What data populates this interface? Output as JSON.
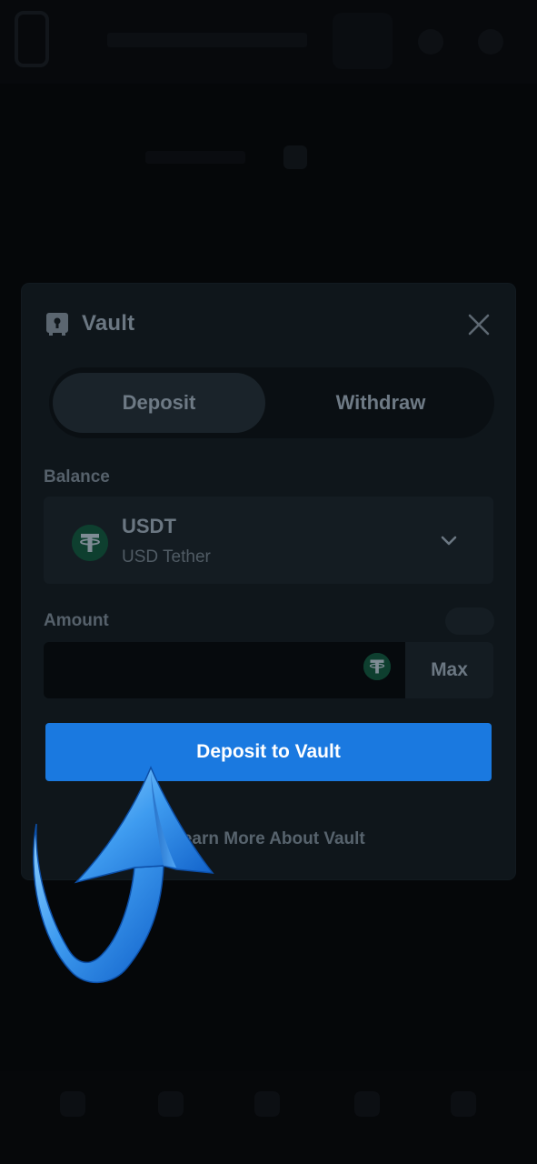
{
  "modal": {
    "title": "Vault",
    "title_icon": "vault-icon",
    "close_icon": "close-icon",
    "tabs": [
      {
        "label": "Deposit",
        "active": true
      },
      {
        "label": "Withdraw",
        "active": false
      }
    ],
    "balance_label": "Balance",
    "currency": {
      "code": "USDT",
      "name": "USD Tether",
      "icon": "tether-icon",
      "dropdown_icon": "chevron-down-icon"
    },
    "amount_label": "Amount",
    "amount": {
      "value": "",
      "currency_icon": "tether-icon",
      "max_label": "Max"
    },
    "deposit_button": "Deposit to Vault",
    "learn_more": "Learn More About Vault"
  },
  "overlay": {
    "arrow_icon": "curved-arrow-up-icon"
  },
  "colors": {
    "primary_button": "#1a79e0",
    "modal_bg": "#0f161b",
    "page_bg": "#050709",
    "tether_green": "#26a17b"
  }
}
